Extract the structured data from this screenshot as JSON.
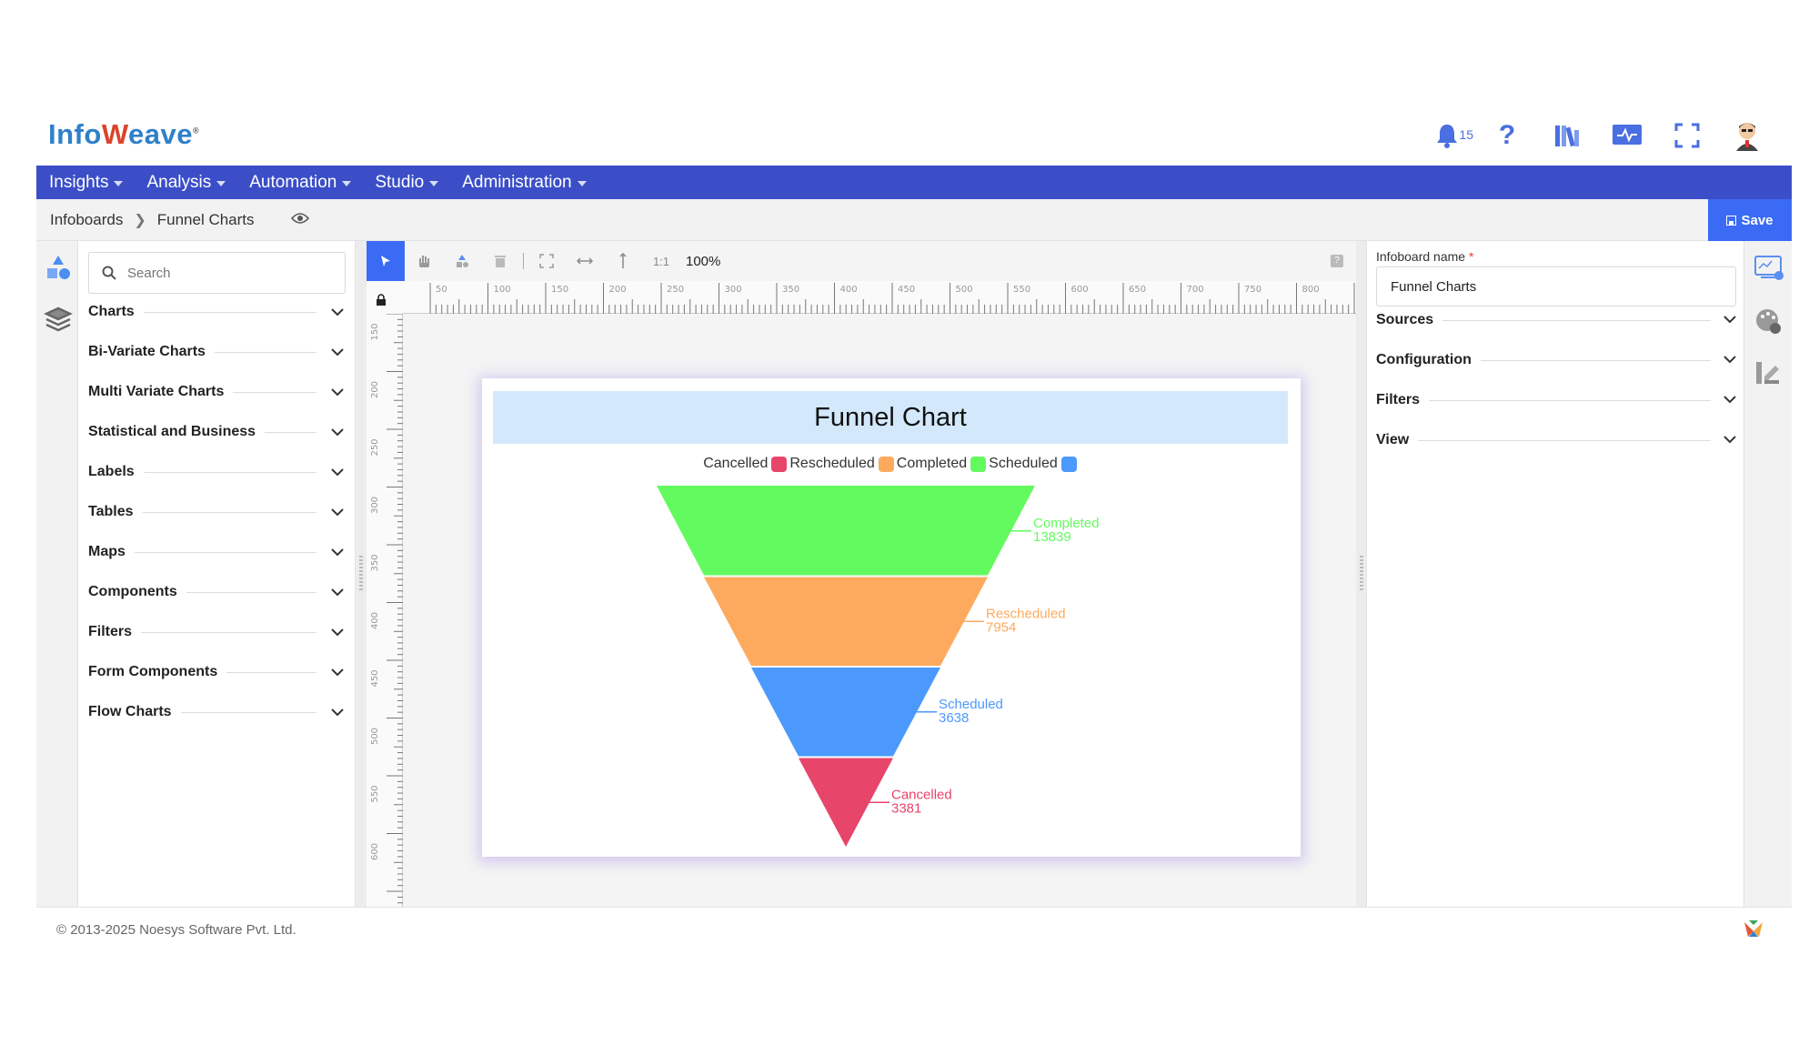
{
  "brand": {
    "logo_text_left": "Info",
    "logo_text_right": "eave"
  },
  "header": {
    "notification_count": "15"
  },
  "menu": [
    {
      "label": "Insights"
    },
    {
      "label": "Analysis"
    },
    {
      "label": "Automation"
    },
    {
      "label": "Studio"
    },
    {
      "label": "Administration"
    }
  ],
  "breadcrumb": {
    "root": "Infoboards",
    "current": "Funnel Charts"
  },
  "toolbar": {
    "save_label": "Save",
    "ratio_label": "1:1",
    "zoom": "100%"
  },
  "left_panel": {
    "search_placeholder": "Search",
    "sections": [
      "Charts",
      "Bi-Variate Charts",
      "Multi Variate Charts",
      "Statistical and Business",
      "Labels",
      "Tables",
      "Maps",
      "Components",
      "Filters",
      "Form Components",
      "Flow Charts"
    ]
  },
  "rulers": {
    "horizontal": [
      "50",
      "100",
      "150",
      "200",
      "250",
      "300",
      "350",
      "400",
      "450",
      "500",
      "550",
      "600",
      "650",
      "700",
      "750",
      "800"
    ],
    "vertical": [
      "150",
      "200",
      "250",
      "300",
      "350",
      "400",
      "450",
      "500",
      "550",
      "600"
    ]
  },
  "right_panel": {
    "name_label": "Infoboard name",
    "name_required_mark": "*",
    "name_value": "Funnel Charts",
    "sections": [
      "Sources",
      "Configuration",
      "Filters",
      "View"
    ]
  },
  "footer": {
    "copyright": "© 2013-2025 Noesys Software Pvt. Ltd."
  },
  "chart_data": {
    "type": "funnel",
    "title": "Funnel Chart",
    "legend": [
      {
        "name": "Cancelled",
        "color": "#e8456b"
      },
      {
        "name": "Rescheduled",
        "color": "#fdaa5f"
      },
      {
        "name": "Completed",
        "color": "#63fa5f"
      },
      {
        "name": "Scheduled",
        "color": "#4b99fc"
      }
    ],
    "stages": [
      {
        "name": "Completed",
        "value": 13839,
        "color": "#63fa5f"
      },
      {
        "name": "Rescheduled",
        "value": 7954,
        "color": "#fdaa5f"
      },
      {
        "name": "Scheduled",
        "value": 3638,
        "color": "#4b99fc"
      },
      {
        "name": "Cancelled",
        "value": 3381,
        "color": "#e8456b"
      }
    ]
  }
}
